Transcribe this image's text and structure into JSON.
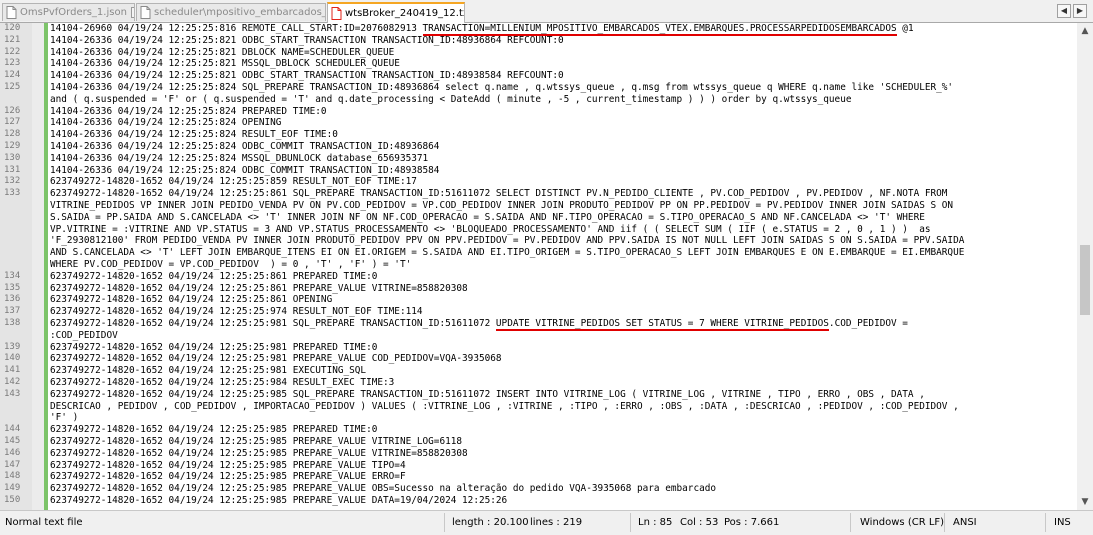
{
  "tabs": [
    {
      "label": "OmsPvfOrders_1.json",
      "active": false
    },
    {
      "label": "scheduler\\mpositivo_embarcados_vtex.ini",
      "active": false
    },
    {
      "label": "wtsBroker_240419_12.txt",
      "active": true
    }
  ],
  "lines": [
    {
      "n": "120",
      "segs": [
        {
          "t": "14104-26960 04/19/24 12:25:25:816 REMOTE_CALL_START:ID=2076082913 "
        },
        {
          "t": "TRANSACTION=MILLENIUM_MPOSITIVO_EMBARCADOS_VTEX.EMBARQUES.PROCESSARPEDIDOSEMBARCADOS",
          "u": true
        },
        {
          "t": " @1"
        }
      ]
    },
    {
      "n": "121",
      "segs": [
        {
          "t": "14104-26336 04/19/24 12:25:25:821 ODBC_START_TRANSACTION TRANSACTION_ID:48936864 REFCOUNT:0"
        }
      ]
    },
    {
      "n": "122",
      "segs": [
        {
          "t": "14104-26336 04/19/24 12:25:25:821 DBLOCK NAME=SCHEDULER_QUEUE"
        }
      ]
    },
    {
      "n": "123",
      "segs": [
        {
          "t": "14104-26336 04/19/24 12:25:25:821 MSSQL_DBLOCK SCHEDULER_QUEUE"
        }
      ]
    },
    {
      "n": "124",
      "segs": [
        {
          "t": "14104-26336 04/19/24 12:25:25:821 ODBC_START_TRANSACTION TRANSACTION_ID:48938584 REFCOUNT:0"
        }
      ]
    },
    {
      "n": "125",
      "segs": [
        {
          "t": "14104-26336 04/19/24 12:25:25:824 SQL_PREPARE TRANSACTION_ID:48936864 select q.name , q.wtssys_queue , q.msg from wtssys_queue q WHERE q.name like 'SCHEDULER_%'"
        }
      ]
    },
    {
      "n": "",
      "segs": [
        {
          "t": "and ( q.suspended = 'F' or ( q.suspended = 'T' and q.date_processing < DateAdd ( minute , -5 , current_timestamp ) ) ) order by q.wtssys_queue"
        }
      ]
    },
    {
      "n": "126",
      "segs": [
        {
          "t": "14104-26336 04/19/24 12:25:25:824 PREPARED TIME:0"
        }
      ]
    },
    {
      "n": "127",
      "segs": [
        {
          "t": "14104-26336 04/19/24 12:25:25:824 OPENING"
        }
      ]
    },
    {
      "n": "128",
      "segs": [
        {
          "t": "14104-26336 04/19/24 12:25:25:824 RESULT_EOF TIME:0"
        }
      ]
    },
    {
      "n": "129",
      "segs": [
        {
          "t": "14104-26336 04/19/24 12:25:25:824 ODBC_COMMIT TRANSACTION_ID:48936864"
        }
      ]
    },
    {
      "n": "130",
      "segs": [
        {
          "t": "14104-26336 04/19/24 12:25:25:824 MSSQL_DBUNLOCK database_656935371"
        }
      ]
    },
    {
      "n": "131",
      "segs": [
        {
          "t": "14104-26336 04/19/24 12:25:25:824 ODBC_COMMIT TRANSACTION_ID:48938584"
        }
      ]
    },
    {
      "n": "132",
      "segs": [
        {
          "t": "623749272-14820-1652 04/19/24 12:25:25:859 RESULT_NOT_EOF TIME:17"
        }
      ]
    },
    {
      "n": "133",
      "segs": [
        {
          "t": "623749272-14820-1652 04/19/24 12:25:25:861 SQL_PREPARE TRANSACTION_ID:51611072 SELECT DISTINCT PV.N_PEDIDO_CLIENTE , PV.COD_PEDIDOV , PV.PEDIDOV , NF.NOTA FROM"
        }
      ]
    },
    {
      "n": "",
      "segs": [
        {
          "t": "VITRINE_PEDIDOS VP INNER JOIN PEDIDO_VENDA PV ON PV.COD_PEDIDOV = VP.COD_PEDIDOV INNER JOIN PRODUTO_PEDIDOV PP ON PP.PEDIDOV = PV.PEDIDOV INNER JOIN SAIDAS S ON"
        }
      ]
    },
    {
      "n": "",
      "segs": [
        {
          "t": "S.SAIDA = PP.SAIDA AND S.CANCELADA <> 'T' INNER JOIN NF ON NF.COD_OPERACAO = S.SAIDA AND NF.TIPO_OPERACAO = S.TIPO_OPERACAO_S AND NF.CANCELADA <> 'T' WHERE"
        }
      ]
    },
    {
      "n": "",
      "segs": [
        {
          "t": "VP.VITRINE = :VITRINE AND VP.STATUS = 3 AND VP.STATUS_PROCESSAMENTO <> 'BLOQUEADO_PROCESSAMENTO' AND iif ( ( SELECT SUM ( IIF ( e.STATUS = 2 , 0 , 1 ) )  as"
        }
      ]
    },
    {
      "n": "",
      "segs": [
        {
          "t": "'F_2930812100' FROM PEDIDO_VENDA PV INNER JOIN PRODUTO_PEDIDOV PPV ON PPV.PEDIDOV = PV.PEDIDOV AND PPV.SAIDA IS NOT NULL LEFT JOIN SAIDAS S ON S.SAIDA = PPV.SAIDA"
        }
      ]
    },
    {
      "n": "",
      "segs": [
        {
          "t": "AND S.CANCELADA <> 'T' LEFT JOIN EMBARQUE_ITENS EI ON EI.ORIGEM = S.SAIDA AND EI.TIPO_ORIGEM = S.TIPO_OPERACAO_S LEFT JOIN EMBARQUES E ON E.EMBARQUE = EI.EMBARQUE"
        }
      ]
    },
    {
      "n": "",
      "segs": [
        {
          "t": "WHERE PV.COD_PEDIDOV = VP.COD_PEDIDOV  ) = 0 , 'T' , 'F' ) = 'T'"
        }
      ]
    },
    {
      "n": "134",
      "segs": [
        {
          "t": "623749272-14820-1652 04/19/24 12:25:25:861 PREPARED TIME:0"
        }
      ]
    },
    {
      "n": "135",
      "segs": [
        {
          "t": "623749272-14820-1652 04/19/24 12:25:25:861 PREPARE_VALUE VITRINE=858820308"
        }
      ]
    },
    {
      "n": "136",
      "segs": [
        {
          "t": "623749272-14820-1652 04/19/24 12:25:25:861 OPENING"
        }
      ]
    },
    {
      "n": "137",
      "segs": [
        {
          "t": "623749272-14820-1652 04/19/24 12:25:25:974 RESULT_NOT_EOF TIME:114"
        }
      ]
    },
    {
      "n": "138",
      "segs": [
        {
          "t": "623749272-14820-1652 04/19/24 12:25:25:981 SQL_PREPARE TRANSACTION_ID:51611072 "
        },
        {
          "t": "UPDATE VITRINE_PEDIDOS SET STATUS = 7 WHERE VITRINE_PEDIDOS",
          "u": true
        },
        {
          "t": ".COD_PEDIDOV ="
        }
      ]
    },
    {
      "n": "",
      "segs": [
        {
          "t": ":COD_PEDIDOV"
        }
      ]
    },
    {
      "n": "139",
      "segs": [
        {
          "t": "623749272-14820-1652 04/19/24 12:25:25:981 PREPARED TIME:0"
        }
      ]
    },
    {
      "n": "140",
      "segs": [
        {
          "t": "623749272-14820-1652 04/19/24 12:25:25:981 PREPARE_VALUE COD_PEDIDOV=VQA-3935068"
        }
      ]
    },
    {
      "n": "141",
      "segs": [
        {
          "t": "623749272-14820-1652 04/19/24 12:25:25:981 EXECUTING_SQL"
        }
      ]
    },
    {
      "n": "142",
      "segs": [
        {
          "t": "623749272-14820-1652 04/19/24 12:25:25:984 RESULT_EXEC TIME:3"
        }
      ]
    },
    {
      "n": "143",
      "segs": [
        {
          "t": "623749272-14820-1652 04/19/24 12:25:25:985 SQL_PREPARE TRANSACTION_ID:51611072 INSERT INTO VITRINE_LOG ( VITRINE_LOG , VITRINE , TIPO , ERRO , OBS , DATA ,"
        }
      ]
    },
    {
      "n": "",
      "segs": [
        {
          "t": "DESCRICAO , PEDIDOV , COD_PEDIDOV , IMPORTACAO_PEDIDOV ) VALUES ( :VITRINE_LOG , :VITRINE , :TIPO , :ERRO , :OBS , :DATA , :DESCRICAO , :PEDIDOV , :COD_PEDIDOV ,"
        }
      ]
    },
    {
      "n": "",
      "segs": [
        {
          "t": "'F' )"
        }
      ]
    },
    {
      "n": "144",
      "segs": [
        {
          "t": "623749272-14820-1652 04/19/24 12:25:25:985 PREPARED TIME:0"
        }
      ]
    },
    {
      "n": "145",
      "segs": [
        {
          "t": "623749272-14820-1652 04/19/24 12:25:25:985 PREPARE_VALUE VITRINE_LOG=6118"
        }
      ]
    },
    {
      "n": "146",
      "segs": [
        {
          "t": "623749272-14820-1652 04/19/24 12:25:25:985 PREPARE_VALUE VITRINE=858820308"
        }
      ]
    },
    {
      "n": "147",
      "segs": [
        {
          "t": "623749272-14820-1652 04/19/24 12:25:25:985 PREPARE_VALUE TIPO=4"
        }
      ]
    },
    {
      "n": "148",
      "segs": [
        {
          "t": "623749272-14820-1652 04/19/24 12:25:25:985 PREPARE_VALUE ERRO=F"
        }
      ]
    },
    {
      "n": "149",
      "segs": [
        {
          "t": "623749272-14820-1652 04/19/24 12:25:25:985 PREPARE_VALUE OBS=Sucesso na alteração do pedido VQA-3935068 para embarcado"
        }
      ]
    },
    {
      "n": "150",
      "segs": [
        {
          "t": "623749272-14820-1652 04/19/24 12:25:25:985 PREPARE_VALUE DATA=19/04/2024 12:25:26"
        }
      ]
    }
  ],
  "status": {
    "filetype": "Normal text file",
    "length": "length : 20.100",
    "lines": "lines : 219",
    "ln": "Ln : 85",
    "col": "Col : 53",
    "pos": "Pos : 7.661",
    "eol": "Windows (CR LF)",
    "encoding": "ANSI",
    "mode": "INS"
  },
  "scroll": {
    "up": "▲",
    "down": "▼",
    "left": "◀",
    "right": "▶"
  },
  "colors": {
    "underline": "#e00000",
    "active_tab_accent": "#f5a623",
    "saved_bar": "#7dc46a"
  },
  "icons": [
    "file-icon",
    "close-icon"
  ]
}
